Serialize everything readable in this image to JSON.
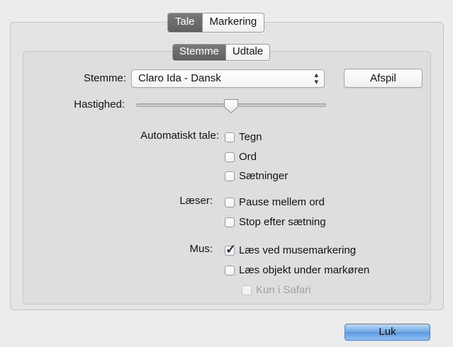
{
  "top_tabs": [
    {
      "label": "Tale",
      "selected": true
    },
    {
      "label": "Markering",
      "selected": false
    }
  ],
  "sub_tabs": [
    {
      "label": "Stemme",
      "selected": true
    },
    {
      "label": "Udtale",
      "selected": false
    }
  ],
  "voice": {
    "label": "Stemme:",
    "value": "Claro Ida - Dansk",
    "play_button": "Afspil"
  },
  "speed": {
    "label": "Hastighed:",
    "level": 0.5
  },
  "auto_speak": {
    "label": "Automatiskt tale:",
    "options": [
      {
        "label": "Tegn",
        "checked": false
      },
      {
        "label": "Ord",
        "checked": false
      },
      {
        "label": "Sætninger",
        "checked": false
      }
    ]
  },
  "reader": {
    "label": "Læser:",
    "options": [
      {
        "label": "Pause mellem ord",
        "checked": false
      },
      {
        "label": "Stop efter sætning",
        "checked": false
      }
    ]
  },
  "mouse": {
    "label": "Mus:",
    "options": [
      {
        "label": "Læs ved musemarkering",
        "checked": true
      },
      {
        "label": "Læs objekt under markøren",
        "checked": false
      }
    ],
    "sub_option": {
      "label": "Kun i Safari",
      "checked": false,
      "enabled": false
    }
  },
  "close_button": "Luk",
  "colors": {
    "accent": "#5b97de",
    "selected_segment": "#6b6b6b"
  }
}
